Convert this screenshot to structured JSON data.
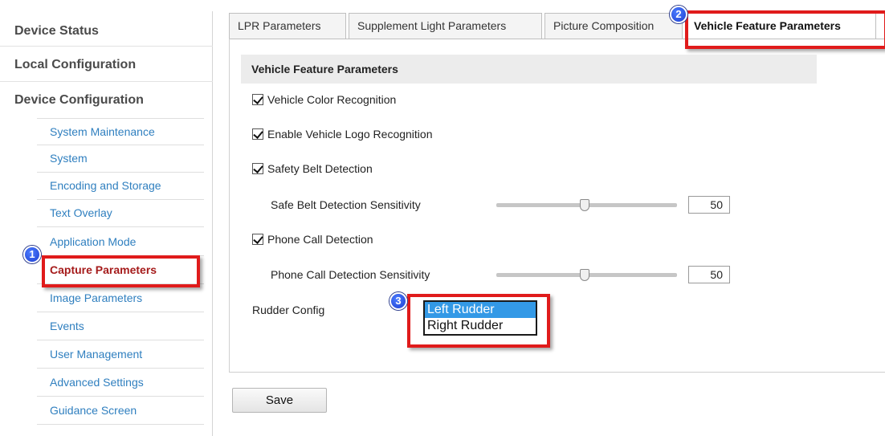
{
  "sidebar": {
    "top_items": [
      "Device Status",
      "Local Configuration",
      "Device Configuration"
    ],
    "sub_items": [
      "System Maintenance",
      "System",
      "Encoding and Storage",
      "Text Overlay",
      "Application Mode",
      "Capture Parameters",
      "Image Parameters",
      "Events",
      "User Management",
      "Advanced Settings",
      "Guidance Screen"
    ],
    "active_index": 5
  },
  "tabs": [
    "LPR Parameters",
    "Supplement Light Parameters",
    "Picture Composition",
    "Vehicle Feature Parameters"
  ],
  "active_tab": 3,
  "section": {
    "title": "Vehicle Feature Parameters",
    "vehicle_color": "Vehicle Color Recognition",
    "vehicle_logo": "Enable Vehicle Logo Recognition",
    "safety_belt": "Safety Belt Detection",
    "belt_sensitivity_label": "Safe Belt Detection Sensitivity",
    "belt_sensitivity_value": "50",
    "phone_call": "Phone Call Detection",
    "phone_sensitivity_label": "Phone Call Detection Sensitivity",
    "phone_sensitivity_value": "50",
    "rudder_label": "Rudder Config",
    "rudder_options": [
      "Left Rudder",
      "Right Rudder"
    ]
  },
  "save_label": "Save",
  "badges": [
    "1",
    "2",
    "3"
  ],
  "colors": {
    "accent_red": "#e01b1b",
    "active_nav": "#a51b1b",
    "link_blue": "#2f7fbf",
    "selection_blue": "#3399e6"
  }
}
